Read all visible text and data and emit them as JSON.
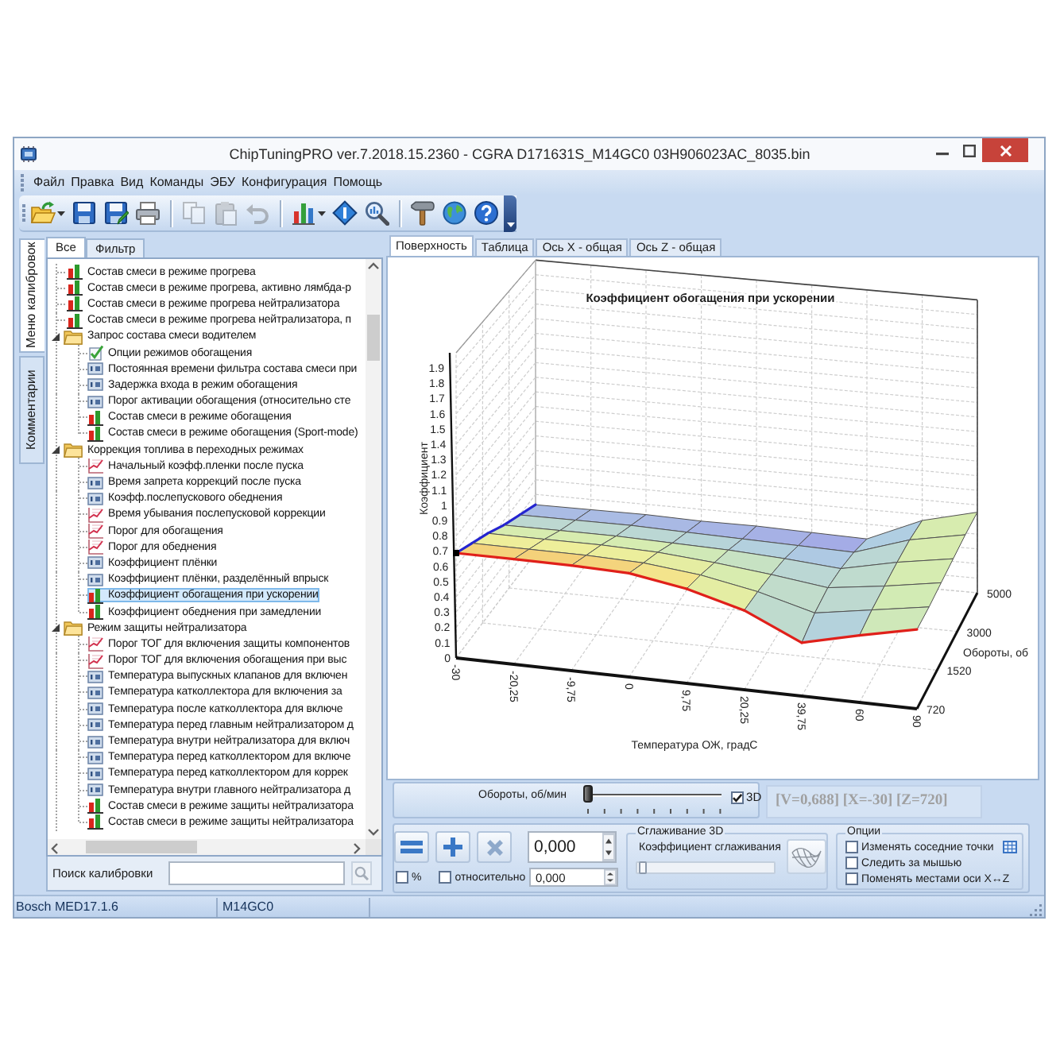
{
  "window": {
    "title": "ChipTuningPRO ver.7.2018.15.2360 - CGRA D171631S_M14GC0 03H906023AC_8035.bin"
  },
  "menu": [
    "Файл",
    "Правка",
    "Вид",
    "Команды",
    "ЭБУ",
    "Конфигурация",
    "Помощь"
  ],
  "toolbar": [
    {
      "kind": "open",
      "dropdown": true,
      "disabled": false
    },
    {
      "kind": "save",
      "disabled": false
    },
    {
      "kind": "save_as",
      "disabled": false
    },
    {
      "kind": "print",
      "disabled": false
    },
    {
      "kind": "separator"
    },
    {
      "kind": "copy",
      "disabled": true
    },
    {
      "kind": "paste",
      "disabled": true
    },
    {
      "kind": "undo",
      "disabled": true
    },
    {
      "kind": "separator"
    },
    {
      "kind": "chart",
      "dropdown": true,
      "disabled": false
    },
    {
      "kind": "diamond",
      "disabled": false
    },
    {
      "kind": "zoom",
      "disabled": false
    },
    {
      "kind": "separator"
    },
    {
      "kind": "tool",
      "disabled": false
    },
    {
      "kind": "globe",
      "disabled": false
    },
    {
      "kind": "help",
      "disabled": false
    }
  ],
  "side_tabs": [
    {
      "label": "Меню калибровок",
      "selected": true
    },
    {
      "label": "Комментарии",
      "selected": false
    }
  ],
  "calibrations": {
    "tabs": [
      {
        "label": "Все",
        "selected": true
      },
      {
        "label": "Фильтр",
        "selected": false
      }
    ],
    "tree": [
      {
        "label": "Состав смеси в режиме прогрева",
        "kind": "map",
        "selected": false
      },
      {
        "label": "Состав смеси в режиме прогрева, активно лямбда-р",
        "kind": "map",
        "selected": false
      },
      {
        "label": "Состав смеси в режиме прогрева нейтрализатора",
        "kind": "map",
        "selected": false
      },
      {
        "label": "Состав смеси в режиме прогрева нейтрализатора, п",
        "kind": "map",
        "selected": false
      },
      {
        "label": "Запрос состава смеси водителем",
        "kind": "folder",
        "selected": false,
        "expanded": true,
        "children": [
          {
            "label": "Опции режимов обогащения",
            "kind": "options",
            "selected": false
          },
          {
            "label": "Постоянная времени фильтра состава смеси при",
            "kind": "value",
            "selected": false
          },
          {
            "label": "Задержка входа в режим обогащения",
            "kind": "value",
            "selected": false
          },
          {
            "label": "Порог активации обогащения (относительно сте",
            "kind": "value",
            "selected": false
          },
          {
            "label": "Состав смеси в режиме обогащения",
            "kind": "map",
            "selected": false
          },
          {
            "label": "Состав смеси в режиме обогащения (Sport-mode)",
            "kind": "map",
            "selected": false
          }
        ]
      },
      {
        "label": "Коррекция топлива в переходных режимах",
        "kind": "folder",
        "selected": false,
        "expanded": true,
        "children": [
          {
            "label": "Начальный коэфф.пленки после пуска",
            "kind": "curve",
            "selected": false
          },
          {
            "label": "Время запрета коррекций после пуска",
            "kind": "value",
            "selected": false
          },
          {
            "label": "Коэфф.послепускового обеднения",
            "kind": "value",
            "selected": false
          },
          {
            "label": "Время убывания послепусковой коррекции",
            "kind": "curve",
            "selected": false
          },
          {
            "label": "Порог для обогащения",
            "kind": "curve",
            "selected": false
          },
          {
            "label": "Порог для обеднения",
            "kind": "curve",
            "selected": false
          },
          {
            "label": "Коэффициент плёнки",
            "kind": "value",
            "selected": false
          },
          {
            "label": "Коэффициент плёнки, разделённый впрыск",
            "kind": "value",
            "selected": false
          },
          {
            "label": "Коэффициент обогащения при ускорении",
            "kind": "map",
            "selected": true
          },
          {
            "label": "Коэффициент обеднения при замедлении",
            "kind": "map",
            "selected": false
          }
        ]
      },
      {
        "label": "Режим защиты нейтрализатора",
        "kind": "folder",
        "selected": false,
        "expanded": true,
        "children": [
          {
            "label": "Порог ТОГ для включения защиты компонентов",
            "kind": "curve",
            "selected": false
          },
          {
            "label": "Порог ТОГ для включения обогащения при выс",
            "kind": "curve",
            "selected": false
          },
          {
            "label": "Температура выпускных клапанов для включен",
            "kind": "value",
            "selected": false
          },
          {
            "label": "Температура катколлектора для включения за",
            "kind": "value",
            "selected": false
          },
          {
            "label": "Температура после катколлектора для включе",
            "kind": "value",
            "selected": false
          },
          {
            "label": "Температура перед главным нейтрализатором д",
            "kind": "value",
            "selected": false
          },
          {
            "label": "Температура внутри нейтрализатора для включ",
            "kind": "value",
            "selected": false
          },
          {
            "label": "Температура перед катколлектором для включе",
            "kind": "value",
            "selected": false
          },
          {
            "label": "Температура перед катколлектором для коррек",
            "kind": "value",
            "selected": false
          },
          {
            "label": "Температура внутри главного нейтрализатора д",
            "kind": "value",
            "selected": false
          },
          {
            "label": "Состав смеси в режиме защиты нейтрализатора",
            "kind": "map",
            "selected": false
          },
          {
            "label": "Состав смеси в режиме защиты нейтрализатора",
            "kind": "map",
            "selected": false
          }
        ]
      }
    ],
    "search": {
      "label": "Поиск калибровки"
    }
  },
  "view_tabs": [
    {
      "label": "Поверхность",
      "selected": true
    },
    {
      "label": "Таблица",
      "selected": false
    },
    {
      "label": "Ось X - общая",
      "selected": false
    },
    {
      "label": "Ось Z - общая",
      "selected": false
    }
  ],
  "chart": {
    "title": "Коэффициент обогащения при ускорении",
    "y_axis": {
      "label": "Коэффициент",
      "ticks": [
        "1.9",
        "1.8",
        "1.7",
        "1.6",
        "1.5",
        "1.4",
        "1.3",
        "1.2",
        "1.1",
        "1",
        "0.9",
        "0.8",
        "0.7",
        "0.6",
        "0.5",
        "0.4",
        "0.3",
        "0.2",
        "0.1",
        "0"
      ]
    },
    "x_axis": {
      "label": "Температура ОЖ, градС",
      "ticks": [
        "-30",
        "-20,25",
        "-9,75",
        "0",
        "9,75",
        "20,25",
        "39,75",
        "60",
        "90"
      ]
    },
    "z_axis": {
      "label": "Обороты, об",
      "ticks": [
        "720",
        "1520",
        "3000",
        "5000"
      ]
    }
  },
  "axis_slider": {
    "label": "Обороты, об/мин",
    "level": 0,
    "option": {
      "label": "3D",
      "checked": true
    }
  },
  "readout": "[V=0,688] [X=-30] [Z=720]",
  "edit": {
    "buttons": [
      {
        "kind": "equals"
      },
      {
        "kind": "plus"
      },
      {
        "kind": "multiply"
      }
    ],
    "value": "0,000",
    "percent": {
      "label": "%",
      "checked": false
    },
    "relative": {
      "label": "относительно",
      "checked": false,
      "value": "0,000"
    }
  },
  "smoothing": {
    "title": "Сглаживание 3D",
    "label": "Коэффициент сглаживания",
    "level": 0
  },
  "options": {
    "title": "Опции",
    "items": [
      {
        "label": "Изменять соседние точки",
        "checked": false,
        "grid_button": true
      },
      {
        "label": "Следить за мышью",
        "checked": false
      },
      {
        "label": "Поменять местами оси X↔Z",
        "checked": false
      }
    ]
  },
  "status_bar": [
    "Bosch MED17.1.6",
    "M14GC0"
  ]
}
